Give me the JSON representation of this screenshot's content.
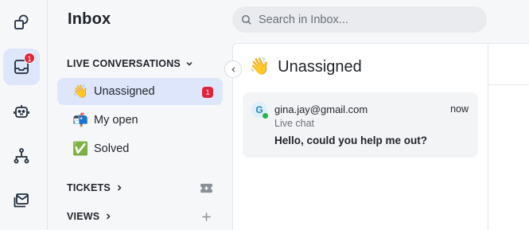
{
  "rail": {
    "inbox_badge": "1"
  },
  "sidebar": {
    "title": "Inbox",
    "live_section": "LIVE CONVERSATIONS",
    "items": [
      {
        "label": "Unassigned",
        "emoji": "👋",
        "badge": "1"
      },
      {
        "label": "My open",
        "emoji": "📬"
      },
      {
        "label": "Solved",
        "emoji": "✅"
      }
    ],
    "tickets_section": "TICKETS",
    "views_section": "VIEWS"
  },
  "search": {
    "placeholder": "Search in Inbox..."
  },
  "panel": {
    "title": "Unassigned",
    "title_emoji": "👋"
  },
  "conversation": {
    "avatar_letter": "G",
    "email": "gina.jay@gmail.com",
    "time": "now",
    "channel": "Live chat",
    "message": "Hello, could you help me out?"
  },
  "colors": {
    "accent_bg": "#dde6fb",
    "badge": "#e0253a",
    "online": "#27b24a",
    "brand_dark": "#1f2d3d"
  }
}
